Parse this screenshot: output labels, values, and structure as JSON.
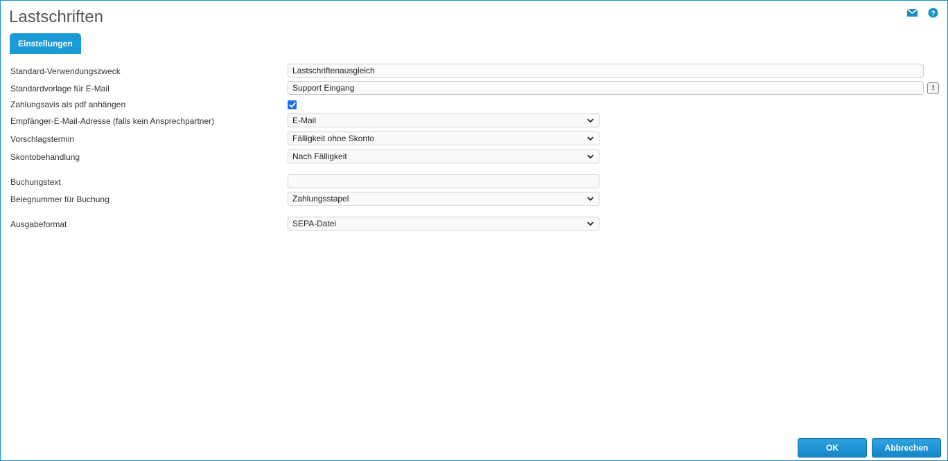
{
  "window": {
    "title": "Lastschriften"
  },
  "tabs": [
    {
      "label": "Einstellungen",
      "active": true
    }
  ],
  "form": {
    "verwendungszweck": {
      "label": "Standard-Verwendungszweck",
      "value": "Lastschriftenausgleich"
    },
    "email_vorlage": {
      "label": "Standardvorlage für E-Mail",
      "value": "Support Eingang",
      "button_label": "!"
    },
    "pdf_anhaengen": {
      "label": "Zahlungsavis als pdf anhängen",
      "checked": true
    },
    "empfaenger_email": {
      "label": "Empfänger-E-Mail-Adresse (falls kein Ansprechpartner)",
      "value": "E-Mail"
    },
    "vorschlagstermin": {
      "label": "Vorschlagstermin",
      "value": "Fälligkeit ohne Skonto"
    },
    "skontobehandlung": {
      "label": "Skontobehandlung",
      "value": "Nach Fälligkeit"
    },
    "buchungstext": {
      "label": "Buchungstext",
      "value": ""
    },
    "belegnummer": {
      "label": "Belegnummer für Buchung",
      "value": "Zahlungsstapel"
    },
    "ausgabeformat": {
      "label": "Ausgabeformat",
      "value": "SEPA-Datei"
    }
  },
  "buttons": {
    "ok": "OK",
    "cancel": "Abbrechen"
  },
  "icons": {
    "mail": "mail-icon",
    "help": "help-icon"
  },
  "colors": {
    "accent": "#1a9ad6",
    "checkbox": "#1a73e8"
  }
}
